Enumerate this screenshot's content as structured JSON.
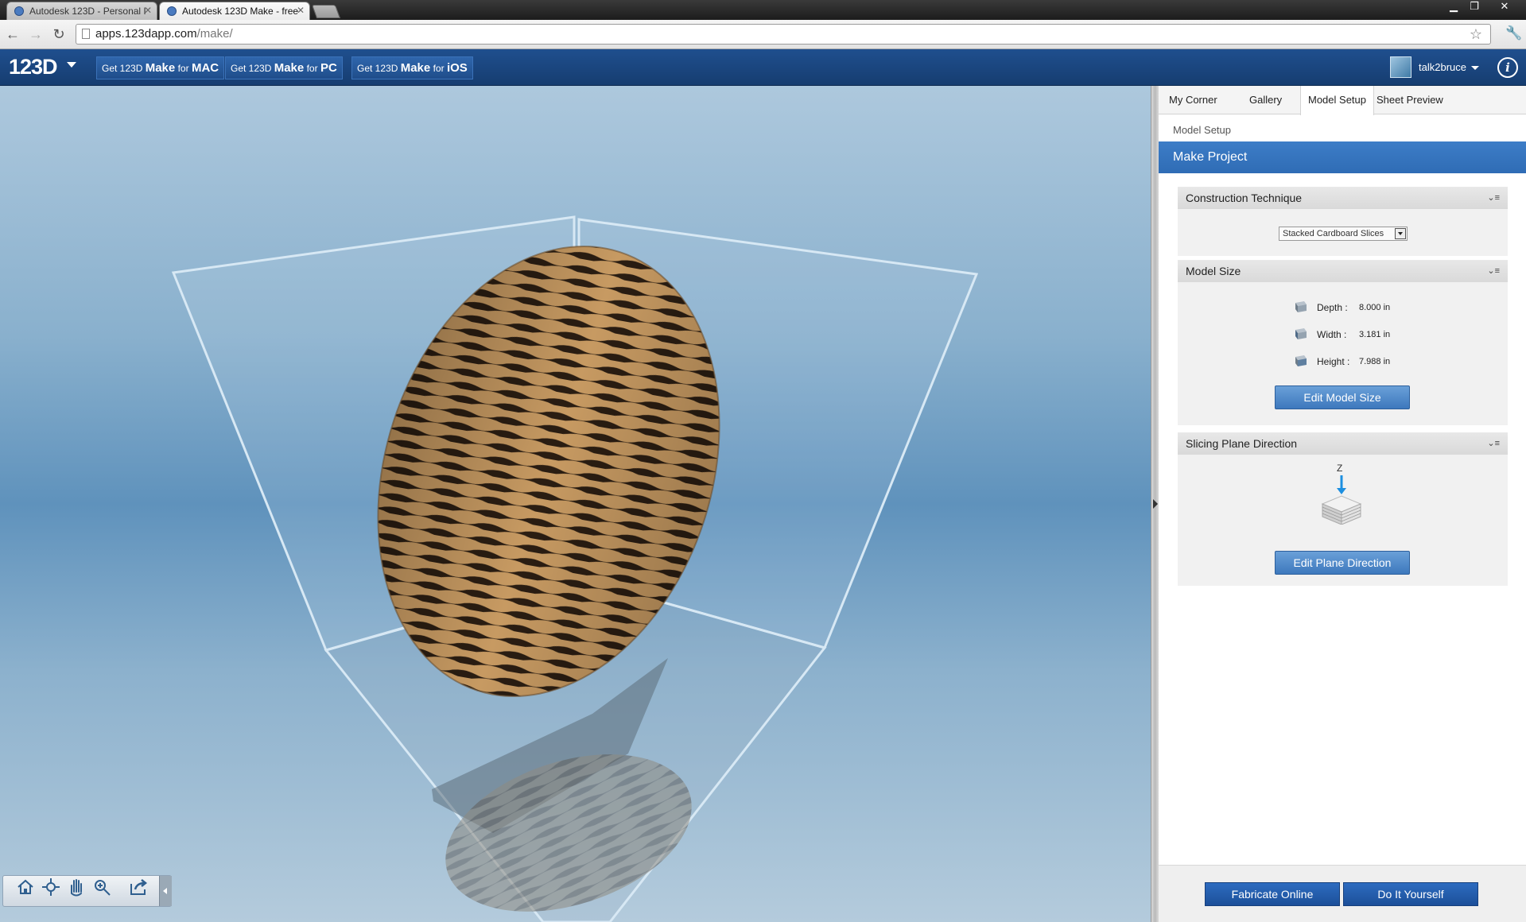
{
  "browser": {
    "tabs": [
      {
        "title": "Autodesk 123D - Personal I"
      },
      {
        "title": "Autodesk 123D Make - free"
      }
    ],
    "url_host": "apps.123dapp.com",
    "url_path": "/make/"
  },
  "header": {
    "logo": "123D",
    "get_buttons": [
      {
        "prefix": "Get 123D",
        "strong": "Make",
        "mid": "for",
        "platform": "MAC"
      },
      {
        "prefix": "Get 123D",
        "strong": "Make",
        "mid": "for",
        "platform": "PC"
      },
      {
        "prefix": "Get 123D",
        "strong": "Make",
        "mid": "for",
        "platform": "iOS"
      }
    ],
    "username": "talk2bruce",
    "info_label": "i"
  },
  "panel": {
    "tabs": [
      {
        "label": "My Corner"
      },
      {
        "label": "Gallery"
      },
      {
        "label": "Model Setup"
      },
      {
        "label": "Sheet Preview"
      }
    ],
    "breadcrumb": "Model Setup",
    "project_title": "Make Project",
    "construction": {
      "title": "Construction Technique",
      "selected": "Stacked Cardboard Slices"
    },
    "model_size": {
      "title": "Model Size",
      "depth_label": "Depth :",
      "depth_value": "8.000 in",
      "width_label": "Width :",
      "width_value": "3.181 in",
      "height_label": "Height :",
      "height_value": "7.988 in",
      "edit_label": "Edit Model Size"
    },
    "slicing": {
      "title": "Slicing Plane Direction",
      "axis": "Z",
      "edit_label": "Edit Plane Direction"
    },
    "footer": {
      "fabricate_label": "Fabricate Online",
      "diy_label": "Do It Yourself"
    }
  }
}
